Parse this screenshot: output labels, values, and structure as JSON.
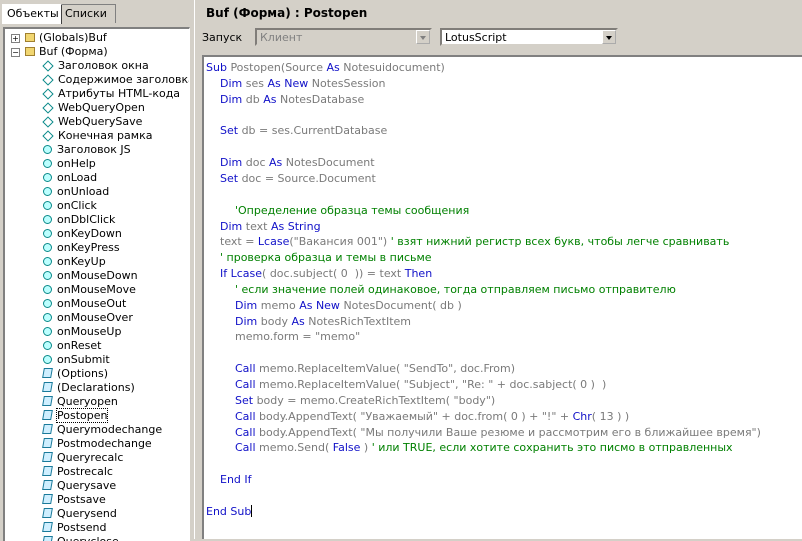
{
  "tabs": [
    {
      "label": "Объекты",
      "active": true
    },
    {
      "label": "Списки",
      "active": false
    }
  ],
  "tree": [
    {
      "label": "(Globals)Buf",
      "icon": "folder-icon",
      "toggle": "+",
      "level": 0
    },
    {
      "label": "Buf (Форма)",
      "icon": "folder-icon",
      "toggle": "−",
      "level": 0
    },
    {
      "label": "Заголовок окна",
      "icon": "diamond-icon",
      "level": 2
    },
    {
      "label": "Содержимое заголовка H",
      "icon": "diamond-icon",
      "level": 2
    },
    {
      "label": "Атрибуты HTML-кода",
      "icon": "diamond-icon",
      "level": 2
    },
    {
      "label": "WebQueryOpen",
      "icon": "diamond-icon",
      "level": 2
    },
    {
      "label": "WebQuerySave",
      "icon": "diamond-icon",
      "level": 2
    },
    {
      "label": "Конечная рамка",
      "icon": "diamond-icon",
      "level": 2
    },
    {
      "label": "Заголовок JS",
      "icon": "circle-icon",
      "level": 2
    },
    {
      "label": "onHelp",
      "icon": "circle-icon",
      "level": 2
    },
    {
      "label": "onLoad",
      "icon": "circle-icon",
      "level": 2
    },
    {
      "label": "onUnload",
      "icon": "circle-icon",
      "level": 2
    },
    {
      "label": "onClick",
      "icon": "circle-icon",
      "level": 2
    },
    {
      "label": "onDblClick",
      "icon": "circle-icon",
      "level": 2
    },
    {
      "label": "onKeyDown",
      "icon": "circle-icon",
      "level": 2
    },
    {
      "label": "onKeyPress",
      "icon": "circle-icon",
      "level": 2
    },
    {
      "label": "onKeyUp",
      "icon": "circle-icon",
      "level": 2
    },
    {
      "label": "onMouseDown",
      "icon": "circle-icon",
      "level": 2
    },
    {
      "label": "onMouseMove",
      "icon": "circle-icon",
      "level": 2
    },
    {
      "label": "onMouseOut",
      "icon": "circle-icon",
      "level": 2
    },
    {
      "label": "onMouseOver",
      "icon": "circle-icon",
      "level": 2
    },
    {
      "label": "onMouseUp",
      "icon": "circle-icon",
      "level": 2
    },
    {
      "label": "onReset",
      "icon": "circle-icon",
      "level": 2
    },
    {
      "label": "onSubmit",
      "icon": "circle-icon",
      "level": 2
    },
    {
      "label": "(Options)",
      "icon": "script-icon",
      "level": 2
    },
    {
      "label": "(Declarations)",
      "icon": "script-icon",
      "level": 2
    },
    {
      "label": "Queryopen",
      "icon": "script-icon",
      "level": 2
    },
    {
      "label": "Postopen",
      "icon": "script-icon",
      "level": 2,
      "selected": true
    },
    {
      "label": "Querymodechange",
      "icon": "script-icon",
      "level": 2
    },
    {
      "label": "Postmodechange",
      "icon": "script-icon",
      "level": 2
    },
    {
      "label": "Queryrecalc",
      "icon": "script-icon",
      "level": 2
    },
    {
      "label": "Postrecalc",
      "icon": "script-icon",
      "level": 2
    },
    {
      "label": "Querysave",
      "icon": "script-icon",
      "level": 2
    },
    {
      "label": "Postsave",
      "icon": "script-icon",
      "level": 2
    },
    {
      "label": "Querysend",
      "icon": "script-icon",
      "level": 2
    },
    {
      "label": "Postsend",
      "icon": "script-icon",
      "level": 2
    },
    {
      "label": "Queryclose",
      "icon": "script-icon",
      "level": 2
    }
  ],
  "header": {
    "title": "Buf (Форма) : Postopen"
  },
  "toolbar": {
    "run_label": "Запуск",
    "run_value": "Клиент",
    "lang_value": "LotusScript"
  },
  "code": [
    {
      "indent": 0,
      "parts": [
        [
          "kw",
          "Sub "
        ],
        [
          "t",
          "Postopen(Source "
        ],
        [
          "kw",
          "As "
        ],
        [
          "t",
          "Notesuidocument)"
        ]
      ]
    },
    {
      "indent": 1,
      "parts": [
        [
          "kw",
          "Dim "
        ],
        [
          "t",
          "ses "
        ],
        [
          "kw",
          "As New "
        ],
        [
          "t",
          "NotesSession"
        ]
      ]
    },
    {
      "indent": 1,
      "parts": [
        [
          "kw",
          "Dim "
        ],
        [
          "t",
          "db "
        ],
        [
          "kw",
          "As "
        ],
        [
          "t",
          "NotesDatabase"
        ]
      ]
    },
    {
      "indent": 0,
      "parts": []
    },
    {
      "indent": 1,
      "parts": [
        [
          "kw",
          "Set "
        ],
        [
          "t",
          "db = ses.CurrentDatabase"
        ]
      ]
    },
    {
      "indent": 0,
      "parts": []
    },
    {
      "indent": 1,
      "parts": [
        [
          "kw",
          "Dim "
        ],
        [
          "t",
          "doc "
        ],
        [
          "kw",
          "As "
        ],
        [
          "t",
          "NotesDocument"
        ]
      ]
    },
    {
      "indent": 1,
      "parts": [
        [
          "kw",
          "Set "
        ],
        [
          "t",
          "doc = Source.Document"
        ]
      ]
    },
    {
      "indent": 0,
      "parts": []
    },
    {
      "indent": 2,
      "parts": [
        [
          "cm",
          "'Определение образца темы сообщения"
        ]
      ]
    },
    {
      "indent": 1,
      "parts": [
        [
          "kw",
          "Dim "
        ],
        [
          "t",
          "text "
        ],
        [
          "kw",
          "As String"
        ]
      ]
    },
    {
      "indent": 1,
      "parts": [
        [
          "t",
          "text = "
        ],
        [
          "kw",
          "Lcase"
        ],
        [
          "t",
          "(\"Вакансия 001\") "
        ],
        [
          "cm",
          "' взят нижний регистр всех букв, чтобы легче сравнивать"
        ]
      ]
    },
    {
      "indent": 1,
      "parts": [
        [
          "cm",
          "' проверка образца и темы в письме"
        ]
      ]
    },
    {
      "indent": 1,
      "parts": [
        [
          "kw",
          "If Lcase"
        ],
        [
          "t",
          "( doc.subject( 0  )) = text "
        ],
        [
          "kw",
          "Then"
        ]
      ]
    },
    {
      "indent": 2,
      "parts": [
        [
          "cm",
          "' если значение полей одинаковое, тогда отправляем письмо отправителю"
        ]
      ]
    },
    {
      "indent": 2,
      "parts": [
        [
          "kw",
          "Dim "
        ],
        [
          "t",
          "memo "
        ],
        [
          "kw",
          "As New "
        ],
        [
          "t",
          "NotesDocument( db )"
        ]
      ]
    },
    {
      "indent": 2,
      "parts": [
        [
          "kw",
          "Dim "
        ],
        [
          "t",
          "body "
        ],
        [
          "kw",
          "As "
        ],
        [
          "t",
          "NotesRichTextItem"
        ]
      ]
    },
    {
      "indent": 2,
      "parts": [
        [
          "t",
          "memo.form = \"memo\""
        ]
      ]
    },
    {
      "indent": 0,
      "parts": []
    },
    {
      "indent": 2,
      "parts": [
        [
          "kw",
          "Call "
        ],
        [
          "t",
          "memo.ReplaceItemValue( \"SendTo\", doc.From)"
        ]
      ]
    },
    {
      "indent": 2,
      "parts": [
        [
          "kw",
          "Call "
        ],
        [
          "t",
          "memo.ReplaceItemValue( \"Subject\", \"Re: \" + doc.sabject( 0 )  )"
        ]
      ]
    },
    {
      "indent": 2,
      "parts": [
        [
          "kw",
          "Set "
        ],
        [
          "t",
          "body = memo.CreateRichTextItem( \"body\")"
        ]
      ]
    },
    {
      "indent": 2,
      "parts": [
        [
          "kw",
          "Call "
        ],
        [
          "t",
          "body.AppendText( \"Уважаемый\" + doc.from( 0 ) + \"!\" + "
        ],
        [
          "kw",
          "Chr"
        ],
        [
          "t",
          "( 13 ) )"
        ]
      ]
    },
    {
      "indent": 2,
      "parts": [
        [
          "kw",
          "Call "
        ],
        [
          "t",
          "body.AppendText( \"Мы получили Ваше резюме и рассмотрим его в ближайшее время\")"
        ]
      ]
    },
    {
      "indent": 2,
      "parts": [
        [
          "kw",
          "Call "
        ],
        [
          "t",
          "memo.Send( "
        ],
        [
          "kw",
          "False"
        ],
        [
          "t",
          " ) "
        ],
        [
          "cm",
          "' или TRUE, если хотите сохранить это писмо в отправленных"
        ]
      ]
    },
    {
      "indent": 0,
      "parts": []
    },
    {
      "indent": 1,
      "parts": [
        [
          "kw",
          "End If"
        ]
      ]
    },
    {
      "indent": 0,
      "parts": []
    },
    {
      "indent": 0,
      "parts": [
        [
          "kw",
          "End Sub"
        ]
      ],
      "cursor": true
    }
  ]
}
